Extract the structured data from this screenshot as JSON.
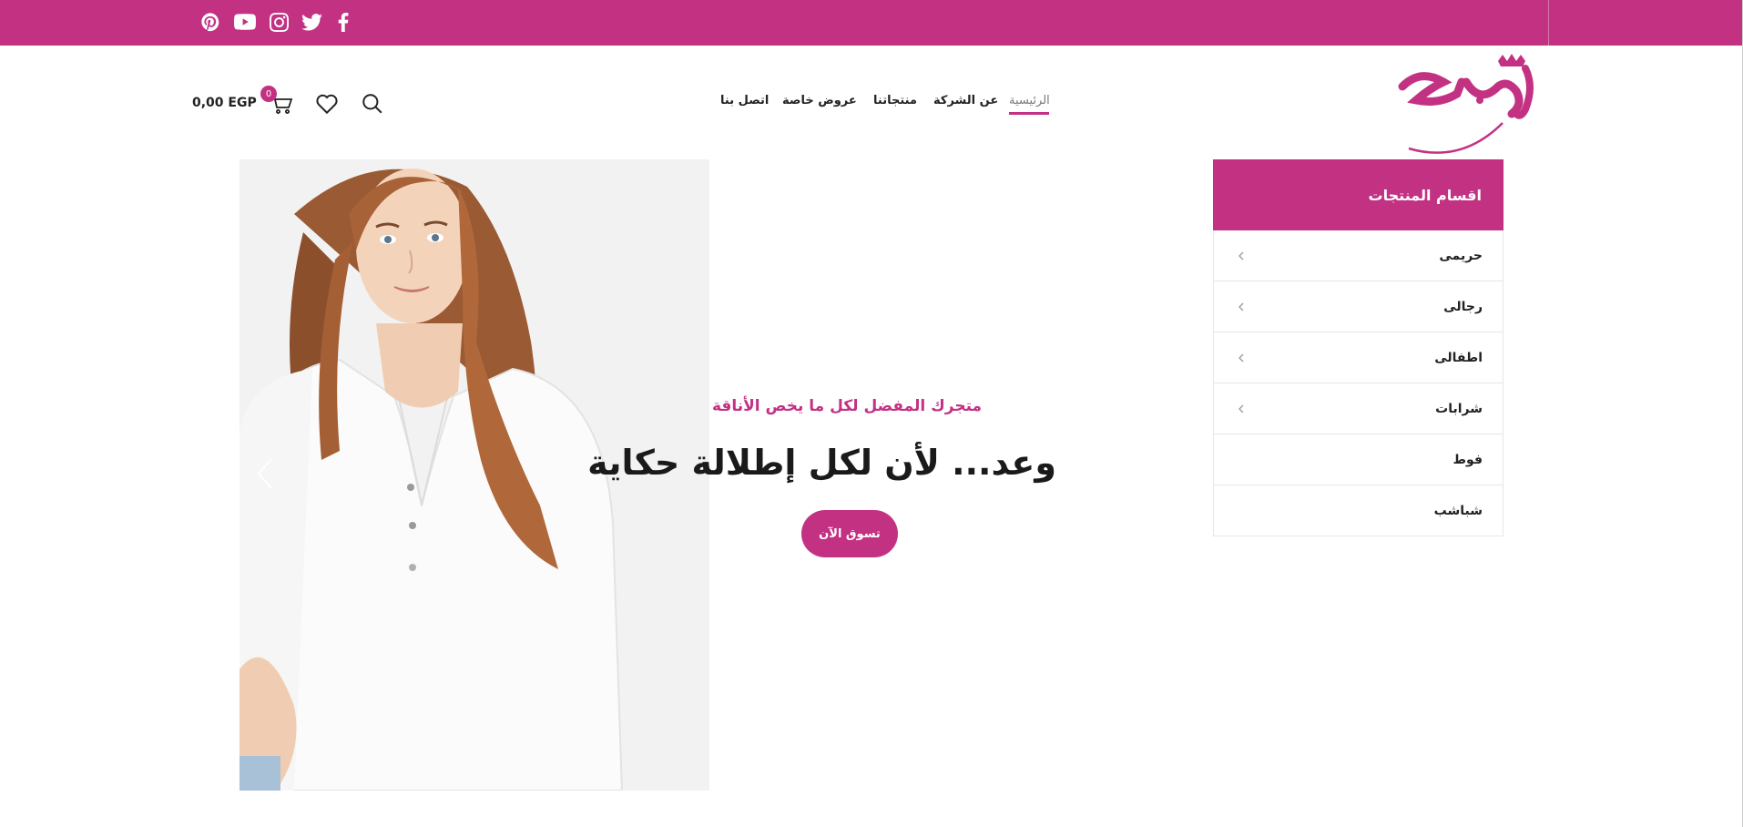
{
  "colors": {
    "brand": "#c33183",
    "text": "#222222",
    "muted": "#777777"
  },
  "social": [
    {
      "name": "pinterest-icon"
    },
    {
      "name": "youtube-icon"
    },
    {
      "name": "instagram-icon"
    },
    {
      "name": "twitter-icon"
    },
    {
      "name": "facebook-icon"
    }
  ],
  "nav": {
    "items": [
      {
        "label": "الرئيسية",
        "active": true
      },
      {
        "label": "عن الشركة"
      },
      {
        "label": "منتجاتنا"
      },
      {
        "label": "عروض خاصة"
      },
      {
        "label": "اتصل بنا"
      }
    ]
  },
  "header_icons": {
    "search": "search-icon",
    "wishlist": "heart-icon",
    "cart": "cart-icon"
  },
  "cart": {
    "count": "0",
    "total": "0,00 EGP"
  },
  "hero": {
    "subtitle": "متجرك المفضل لكل ما يخص الأناقة",
    "title": "وعد... لأن لكل إطلالة حكاية",
    "button": "تسوق الآن"
  },
  "categories": {
    "title": "اقسام المنتجات",
    "items": [
      {
        "label": "حريمى",
        "has_children": true
      },
      {
        "label": "رجالى",
        "has_children": true
      },
      {
        "label": "اطفالى",
        "has_children": true
      },
      {
        "label": "شرابات",
        "has_children": true
      },
      {
        "label": "فوط",
        "has_children": false
      },
      {
        "label": "شباشب",
        "has_children": false
      }
    ]
  }
}
